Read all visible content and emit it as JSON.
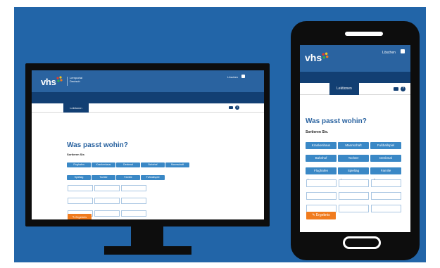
{
  "brand": {
    "name": "vhs",
    "portal_line1": "Lernportal",
    "portal_line2": "Deutsch"
  },
  "header": {
    "logout_label": "Löschen"
  },
  "nav": {
    "active_tab": "Lektionen"
  },
  "exercise": {
    "title": "Was passt wohin?",
    "instruction": "Sortieren Sie.",
    "desktop_words": [
      "Flughafen",
      "Krankenhaus",
      "Denkmal",
      "Bahnhof",
      "Mannschaft",
      "Spieltag",
      "Tochter",
      "Familie",
      "Fußballspiel"
    ],
    "mobile_words": [
      "Krankenhaus",
      "Mannschaft",
      "Fußballspiel",
      "Bahnhof",
      "Tochter",
      "Denkmal",
      "Flughafen",
      "Spieltag",
      "Familie"
    ],
    "columns": [
      "der",
      "das",
      "die"
    ],
    "result_button": "Ergebnis"
  },
  "colors": {
    "background": "#2265a8",
    "header": "#2a63a0",
    "nav": "#123f73",
    "chip": "#3a88c6",
    "button": "#f07b1e"
  },
  "icons": [
    "printer-icon",
    "help-icon",
    "lock-icon",
    "check-icon"
  ]
}
